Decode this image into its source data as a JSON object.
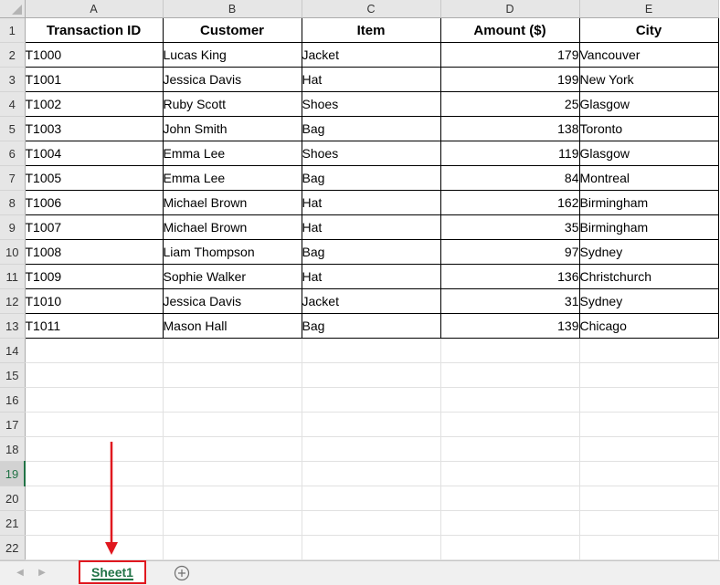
{
  "columns": [
    "A",
    "B",
    "C",
    "D",
    "E"
  ],
  "row_numbers": [
    "1",
    "2",
    "3",
    "4",
    "5",
    "6",
    "7",
    "8",
    "9",
    "10",
    "11",
    "12",
    "13",
    "14",
    "15",
    "16",
    "17",
    "18",
    "19",
    "20",
    "21",
    "22"
  ],
  "active_row": "19",
  "headers": [
    "Transaction ID",
    "Customer",
    "Item",
    "Amount ($)",
    "City"
  ],
  "rows": [
    [
      "T1000",
      "Lucas King",
      "Jacket",
      "179",
      "Vancouver"
    ],
    [
      "T1001",
      "Jessica Davis",
      "Hat",
      "199",
      "New York"
    ],
    [
      "T1002",
      "Ruby Scott",
      "Shoes",
      "25",
      "Glasgow"
    ],
    [
      "T1003",
      "John Smith",
      "Bag",
      "138",
      "Toronto"
    ],
    [
      "T1004",
      "Emma Lee",
      "Shoes",
      "119",
      "Glasgow"
    ],
    [
      "T1005",
      "Emma Lee",
      "Bag",
      "84",
      "Montreal"
    ],
    [
      "T1006",
      "Michael Brown",
      "Hat",
      "162",
      "Birmingham"
    ],
    [
      "T1007",
      "Michael Brown",
      "Hat",
      "35",
      "Birmingham"
    ],
    [
      "T1008",
      "Liam Thompson",
      "Bag",
      "97",
      "Sydney"
    ],
    [
      "T1009",
      "Sophie Walker",
      "Hat",
      "136",
      "Christchurch"
    ],
    [
      "T1010",
      "Jessica Davis",
      "Jacket",
      "31",
      "Sydney"
    ],
    [
      "T1011",
      "Mason Hall",
      "Bag",
      "139",
      "Chicago"
    ]
  ],
  "sheet_tab": {
    "label": "Sheet1"
  },
  "icons": {
    "prev_sheet": "chevron-left-icon",
    "next_sheet": "chevron-right-icon",
    "add_sheet": "plus-circle-icon",
    "annotation": "red-arrow-down-icon"
  },
  "colors": {
    "excel_green": "#217346",
    "highlight_red": "#e0181f",
    "header_gray": "#e6e6e6"
  }
}
